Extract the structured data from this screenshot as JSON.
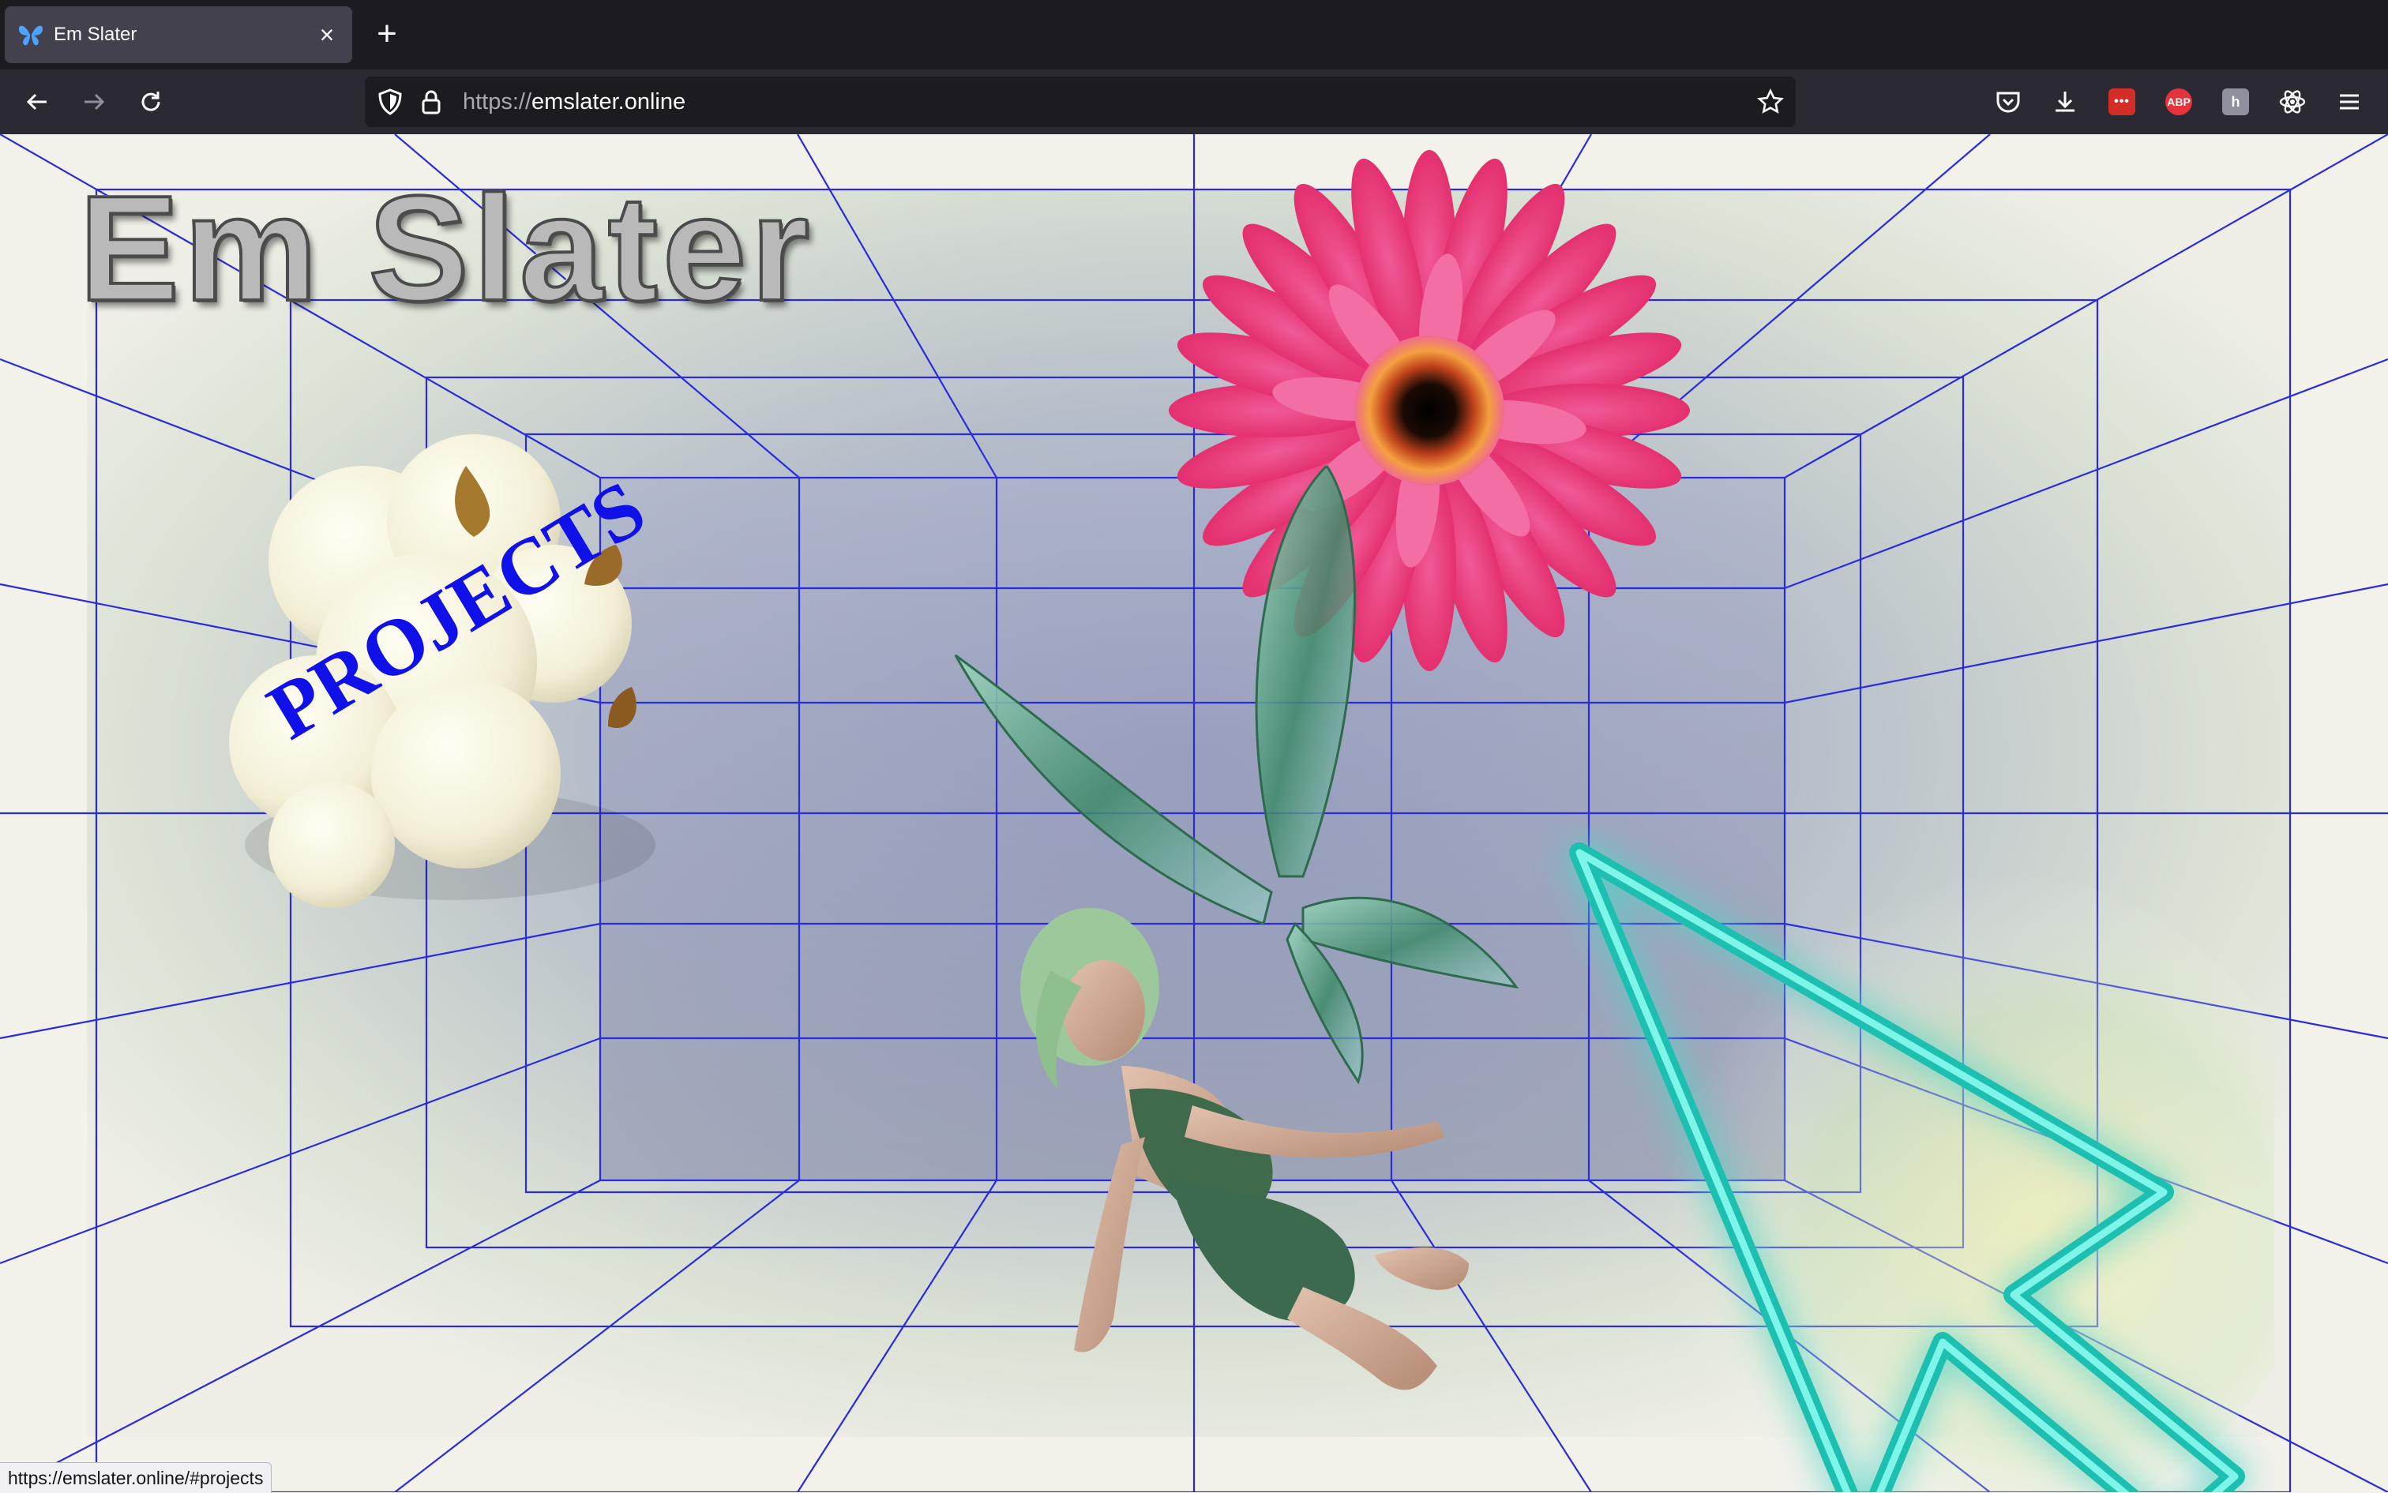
{
  "browser": {
    "tab": {
      "title": "Em Slater",
      "favicon": "butterfly-icon"
    },
    "url": {
      "scheme": "https://",
      "host": "emslater.online"
    },
    "toolbar_icons": [
      "pocket-icon",
      "download-icon",
      "lastpass-icon",
      "adblock-icon",
      "extension-icon",
      "react-devtools-icon",
      "menu-icon"
    ],
    "extensions": {
      "abp_label": "ABP"
    },
    "status_bar": "https://emslater.online/#projects"
  },
  "page": {
    "site_title": "Em Slater",
    "projects_link": "PROJECTS",
    "images": [
      "popcorn-image",
      "pink-gerbera-flower-image",
      "fairy-image",
      "neon-cursor-image"
    ],
    "colors": {
      "grid_lines": "#2a2ae0",
      "link": "#1010e8",
      "neon_cursor": "#3fe0d0"
    }
  }
}
